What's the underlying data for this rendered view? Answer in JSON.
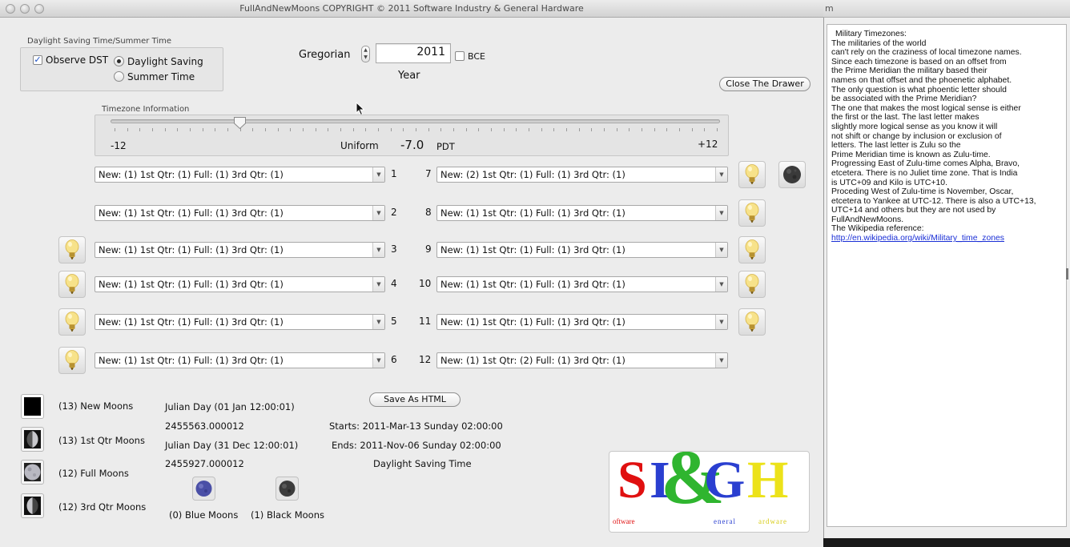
{
  "window": {
    "title": "FullAndNewMoons COPYRIGHT © 2011 Software Industry & General Hardware"
  },
  "drawer_window_title": "m",
  "dst": {
    "group_label": "Daylight Saving Time/Summer Time",
    "observe_label": "Observe DST",
    "observe_checked": true,
    "daylight_label": "Daylight Saving",
    "summer_label": "Summer Time",
    "selected": "Daylight Saving"
  },
  "calendar": {
    "name": "Gregorian",
    "year": "2011",
    "bce_label": "BCE",
    "year_label": "Year"
  },
  "close_drawer_label": "Close The Drawer",
  "timezone": {
    "group_label": "Timezone Information",
    "min_label": "-12",
    "max_label": "+12",
    "uniform_label": "Uniform",
    "offset": "-7.0",
    "abbrev": "PDT",
    "offset_value": -7.0
  },
  "months_left": [
    {
      "text": "New: (1) 1st Qtr: (1) Full: (1) 3rd Qtr: (1)",
      "num": "1",
      "bulb": false
    },
    {
      "text": "New: (1) 1st Qtr: (1) Full: (1) 3rd Qtr: (1)",
      "num": "2",
      "bulb": false
    },
    {
      "text": "New: (1) 1st Qtr: (1) Full: (1) 3rd Qtr: (1)",
      "num": "3",
      "bulb": true
    },
    {
      "text": "New: (1) 1st Qtr: (1) Full: (1) 3rd Qtr: (1)",
      "num": "4",
      "bulb": true
    },
    {
      "text": "New: (1) 1st Qtr: (1) Full: (1) 3rd Qtr: (1)",
      "num": "5",
      "bulb": true
    },
    {
      "text": "New: (1) 1st Qtr: (1) Full: (1) 3rd Qtr: (1)",
      "num": "6",
      "bulb": true
    }
  ],
  "months_right": [
    {
      "text": "New: (2) 1st Qtr: (1) Full: (1) 3rd Qtr: (1)",
      "num": "7",
      "bulb": true
    },
    {
      "text": "New: (1) 1st Qtr: (1) Full: (1) 3rd Qtr: (1)",
      "num": "8",
      "bulb": true
    },
    {
      "text": "New: (1) 1st Qtr: (1) Full: (1) 3rd Qtr: (1)",
      "num": "9",
      "bulb": true
    },
    {
      "text": "New: (1) 1st Qtr: (1) Full: (1) 3rd Qtr: (1)",
      "num": "10",
      "bulb": true
    },
    {
      "text": "New: (1) 1st Qtr: (1) Full: (1) 3rd Qtr: (1)",
      "num": "11",
      "bulb": true
    },
    {
      "text": "New: (1) 1st Qtr: (2) Full: (1) 3rd Qtr: (1)",
      "num": "12",
      "bulb": false
    }
  ],
  "moon_summary": {
    "new": "(13) New Moons",
    "first_qtr": "(13) 1st Qtr Moons",
    "full": "(12) Full Moons",
    "third_qtr": "(12) 3rd Qtr Moons",
    "blue": "(0) Blue Moons",
    "black": "(1) Black Moons"
  },
  "julian": {
    "start_label": "Julian Day (01 Jan 12:00:01)",
    "start_value": "2455563.000012",
    "end_label": "Julian Day (31 Dec 12:00:01)",
    "end_value": "2455927.000012"
  },
  "save_html_label": "Save As HTML",
  "dst_period": {
    "starts": "Starts:  2011-Mar-13 Sunday 02:00:00",
    "ends": "Ends:  2011-Nov-06 Sunday 02:00:00",
    "label": "Daylight Saving Time"
  },
  "logo": {
    "s": "S",
    "i": "I",
    "amp": "&",
    "g": "G",
    "h": "H",
    "software": "oftware",
    "industry": "ndustry",
    "general": "eneral",
    "hardware": "ardware"
  },
  "drawer": {
    "lines": [
      "Military Timezones:",
      "The militaries of the world",
      "can't rely on the craziness of local timezone names.",
      "Since each timezone is based on an offset from",
      "the Prime Meridian the military based their",
      "names on that offset and the phoenetic alphabet.",
      "The only question is what phoentic letter should",
      "be associated with the Prime Meridian?",
      "The one that makes the most logical sense is either",
      "the first or the last. The last letter makes",
      "slightly more logical sense as you know it will",
      "not shift or change by inclusion or exclusion of",
      "letters. The last letter is Zulu so the",
      "Prime Meridian time is known as Zulu-time.",
      "Progressing East of Zulu-time comes Alpha, Bravo,",
      "etcetera. There is no Juliet time zone. That is India",
      "is UTC+09 and Kilo is UTC+10.",
      "Proceding West of Zulu-time is November, Oscar,",
      "etcetera to Yankee at UTC-12. There is also a UTC+13,",
      "UTC+14 and others but they are not used by",
      "FullAndNewMoons.",
      "The Wikipedia reference:"
    ],
    "link": "http://en.wikipedia.org/wiki/Military_time_zones"
  }
}
